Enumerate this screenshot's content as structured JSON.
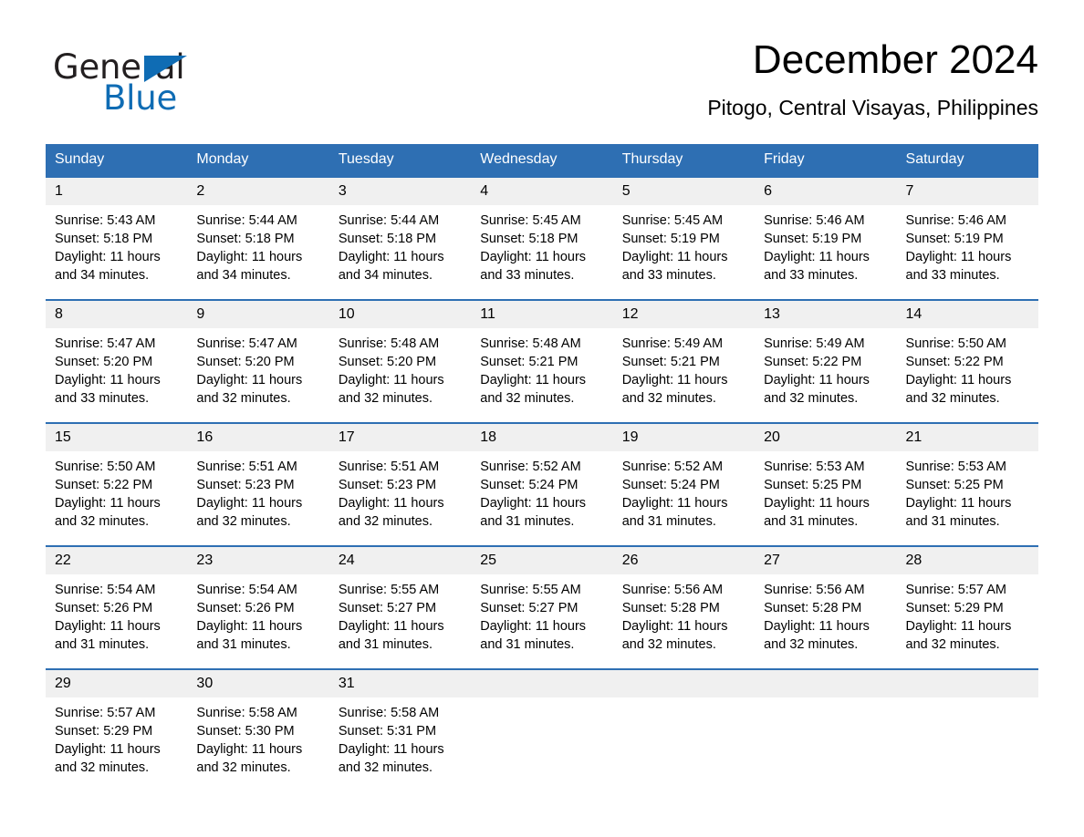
{
  "brand": {
    "name_part1": "General",
    "name_part2": "Blue",
    "accent_color": "#0f6cb4"
  },
  "header": {
    "title": "December 2024",
    "location": "Pitogo, Central Visayas, Philippines"
  },
  "theme": {
    "header_blue": "#2e6fb3",
    "day_number_bg": "#f0f0f0"
  },
  "weekdays": [
    "Sunday",
    "Monday",
    "Tuesday",
    "Wednesday",
    "Thursday",
    "Friday",
    "Saturday"
  ],
  "weeks": [
    [
      {
        "day": "1",
        "sunrise": "Sunrise: 5:43 AM",
        "sunset": "Sunset: 5:18 PM",
        "daylight": "Daylight: 11 hours and 34 minutes."
      },
      {
        "day": "2",
        "sunrise": "Sunrise: 5:44 AM",
        "sunset": "Sunset: 5:18 PM",
        "daylight": "Daylight: 11 hours and 34 minutes."
      },
      {
        "day": "3",
        "sunrise": "Sunrise: 5:44 AM",
        "sunset": "Sunset: 5:18 PM",
        "daylight": "Daylight: 11 hours and 34 minutes."
      },
      {
        "day": "4",
        "sunrise": "Sunrise: 5:45 AM",
        "sunset": "Sunset: 5:18 PM",
        "daylight": "Daylight: 11 hours and 33 minutes."
      },
      {
        "day": "5",
        "sunrise": "Sunrise: 5:45 AM",
        "sunset": "Sunset: 5:19 PM",
        "daylight": "Daylight: 11 hours and 33 minutes."
      },
      {
        "day": "6",
        "sunrise": "Sunrise: 5:46 AM",
        "sunset": "Sunset: 5:19 PM",
        "daylight": "Daylight: 11 hours and 33 minutes."
      },
      {
        "day": "7",
        "sunrise": "Sunrise: 5:46 AM",
        "sunset": "Sunset: 5:19 PM",
        "daylight": "Daylight: 11 hours and 33 minutes."
      }
    ],
    [
      {
        "day": "8",
        "sunrise": "Sunrise: 5:47 AM",
        "sunset": "Sunset: 5:20 PM",
        "daylight": "Daylight: 11 hours and 33 minutes."
      },
      {
        "day": "9",
        "sunrise": "Sunrise: 5:47 AM",
        "sunset": "Sunset: 5:20 PM",
        "daylight": "Daylight: 11 hours and 32 minutes."
      },
      {
        "day": "10",
        "sunrise": "Sunrise: 5:48 AM",
        "sunset": "Sunset: 5:20 PM",
        "daylight": "Daylight: 11 hours and 32 minutes."
      },
      {
        "day": "11",
        "sunrise": "Sunrise: 5:48 AM",
        "sunset": "Sunset: 5:21 PM",
        "daylight": "Daylight: 11 hours and 32 minutes."
      },
      {
        "day": "12",
        "sunrise": "Sunrise: 5:49 AM",
        "sunset": "Sunset: 5:21 PM",
        "daylight": "Daylight: 11 hours and 32 minutes."
      },
      {
        "day": "13",
        "sunrise": "Sunrise: 5:49 AM",
        "sunset": "Sunset: 5:22 PM",
        "daylight": "Daylight: 11 hours and 32 minutes."
      },
      {
        "day": "14",
        "sunrise": "Sunrise: 5:50 AM",
        "sunset": "Sunset: 5:22 PM",
        "daylight": "Daylight: 11 hours and 32 minutes."
      }
    ],
    [
      {
        "day": "15",
        "sunrise": "Sunrise: 5:50 AM",
        "sunset": "Sunset: 5:22 PM",
        "daylight": "Daylight: 11 hours and 32 minutes."
      },
      {
        "day": "16",
        "sunrise": "Sunrise: 5:51 AM",
        "sunset": "Sunset: 5:23 PM",
        "daylight": "Daylight: 11 hours and 32 minutes."
      },
      {
        "day": "17",
        "sunrise": "Sunrise: 5:51 AM",
        "sunset": "Sunset: 5:23 PM",
        "daylight": "Daylight: 11 hours and 32 minutes."
      },
      {
        "day": "18",
        "sunrise": "Sunrise: 5:52 AM",
        "sunset": "Sunset: 5:24 PM",
        "daylight": "Daylight: 11 hours and 31 minutes."
      },
      {
        "day": "19",
        "sunrise": "Sunrise: 5:52 AM",
        "sunset": "Sunset: 5:24 PM",
        "daylight": "Daylight: 11 hours and 31 minutes."
      },
      {
        "day": "20",
        "sunrise": "Sunrise: 5:53 AM",
        "sunset": "Sunset: 5:25 PM",
        "daylight": "Daylight: 11 hours and 31 minutes."
      },
      {
        "day": "21",
        "sunrise": "Sunrise: 5:53 AM",
        "sunset": "Sunset: 5:25 PM",
        "daylight": "Daylight: 11 hours and 31 minutes."
      }
    ],
    [
      {
        "day": "22",
        "sunrise": "Sunrise: 5:54 AM",
        "sunset": "Sunset: 5:26 PM",
        "daylight": "Daylight: 11 hours and 31 minutes."
      },
      {
        "day": "23",
        "sunrise": "Sunrise: 5:54 AM",
        "sunset": "Sunset: 5:26 PM",
        "daylight": "Daylight: 11 hours and 31 minutes."
      },
      {
        "day": "24",
        "sunrise": "Sunrise: 5:55 AM",
        "sunset": "Sunset: 5:27 PM",
        "daylight": "Daylight: 11 hours and 31 minutes."
      },
      {
        "day": "25",
        "sunrise": "Sunrise: 5:55 AM",
        "sunset": "Sunset: 5:27 PM",
        "daylight": "Daylight: 11 hours and 31 minutes."
      },
      {
        "day": "26",
        "sunrise": "Sunrise: 5:56 AM",
        "sunset": "Sunset: 5:28 PM",
        "daylight": "Daylight: 11 hours and 32 minutes."
      },
      {
        "day": "27",
        "sunrise": "Sunrise: 5:56 AM",
        "sunset": "Sunset: 5:28 PM",
        "daylight": "Daylight: 11 hours and 32 minutes."
      },
      {
        "day": "28",
        "sunrise": "Sunrise: 5:57 AM",
        "sunset": "Sunset: 5:29 PM",
        "daylight": "Daylight: 11 hours and 32 minutes."
      }
    ],
    [
      {
        "day": "29",
        "sunrise": "Sunrise: 5:57 AM",
        "sunset": "Sunset: 5:29 PM",
        "daylight": "Daylight: 11 hours and 32 minutes."
      },
      {
        "day": "30",
        "sunrise": "Sunrise: 5:58 AM",
        "sunset": "Sunset: 5:30 PM",
        "daylight": "Daylight: 11 hours and 32 minutes."
      },
      {
        "day": "31",
        "sunrise": "Sunrise: 5:58 AM",
        "sunset": "Sunset: 5:31 PM",
        "daylight": "Daylight: 11 hours and 32 minutes."
      },
      {
        "day": "",
        "sunrise": "",
        "sunset": "",
        "daylight": ""
      },
      {
        "day": "",
        "sunrise": "",
        "sunset": "",
        "daylight": ""
      },
      {
        "day": "",
        "sunrise": "",
        "sunset": "",
        "daylight": ""
      },
      {
        "day": "",
        "sunrise": "",
        "sunset": "",
        "daylight": ""
      }
    ]
  ]
}
